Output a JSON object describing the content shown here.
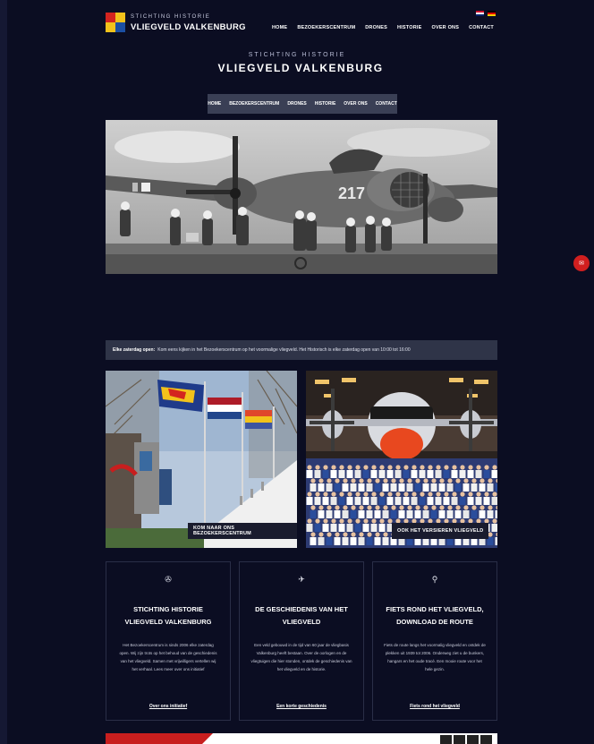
{
  "brand": {
    "small": "STICHTING HISTORIE",
    "name": "VLIEGVELD VALKENBURG"
  },
  "lang_flags": [
    "en-flag",
    "de-flag"
  ],
  "top_nav": [
    "HOME",
    "BEZOEKERSCENTRUM",
    "DRONES",
    "HISTORIE",
    "OVER ONS",
    "CONTACT"
  ],
  "hero": {
    "subtitle": "STICHTING HISTORIE",
    "title": "VLIEGVELD VALKENBURG"
  },
  "sub_nav": [
    "HOME",
    "BEZOEKERSCENTRUM",
    "DRONES",
    "HISTORIE",
    "OVER ONS",
    "CONTACT"
  ],
  "hero_photo": {
    "aircraft_marking": "217"
  },
  "notice": {
    "bold": "Elke zaterdag open:",
    "text": "Kom eens kijken in het Bezoekerscentrum op het voormalige vliegveld. Het Historisch is elke zaterdag open van 10:00 tot 16:00"
  },
  "tiles": [
    {
      "button": "KOM NAAR ONS BEZOEKERSCENTRUM"
    },
    {
      "button": "OOK HET VERSIEREN VLIEGVELD"
    }
  ],
  "cards": [
    {
      "icon": "propeller-icon",
      "title": "STICHTING HISTORIE VLIEGVELD VALKENBURG",
      "text": "Het Bezoekerscentrum is sinds 2006 elke zaterdag open. Wij zijn trots op het behoud van de geschiedenis van het vliegveld. Samen met vrijwilligers vertellen wij het verhaal. Lees meer over ons initiatief",
      "link": "Over ons initiatief"
    },
    {
      "icon": "airplane-icon",
      "title": "DE GESCHIEDENIS VAN HET VLIEGVELD",
      "text": "Een veld gebouwd in de tijd van 60 jaar de vliegbasis Valkenburg heeft bestaan. Over de oorlogen en de vliegtuigen die hier stonden, ontdek de geschiedenis van het vliegveld en de historie.",
      "link": "Een korte geschiedenis"
    },
    {
      "icon": "bicycle-icon",
      "title": "FIETS ROND HET VLIEGVELD, DOWNLOAD DE ROUTE",
      "text": "Fiets de route langs het voormalig vliegveld en ontdek de plekken uit 1939 tot 2006. Onderweg ziet u de bunkers, hangars en het oude tracé. Een mooie route voor het hele gezin.",
      "link": "Fiets rond het vliegveld"
    }
  ],
  "floating_button": {
    "icon": "chat-icon"
  },
  "colors": {
    "background": "#0b0d22",
    "nav_bg": "#3a3f55",
    "notice_bg": "#2f3448",
    "accent_red": "#d11f1f"
  }
}
